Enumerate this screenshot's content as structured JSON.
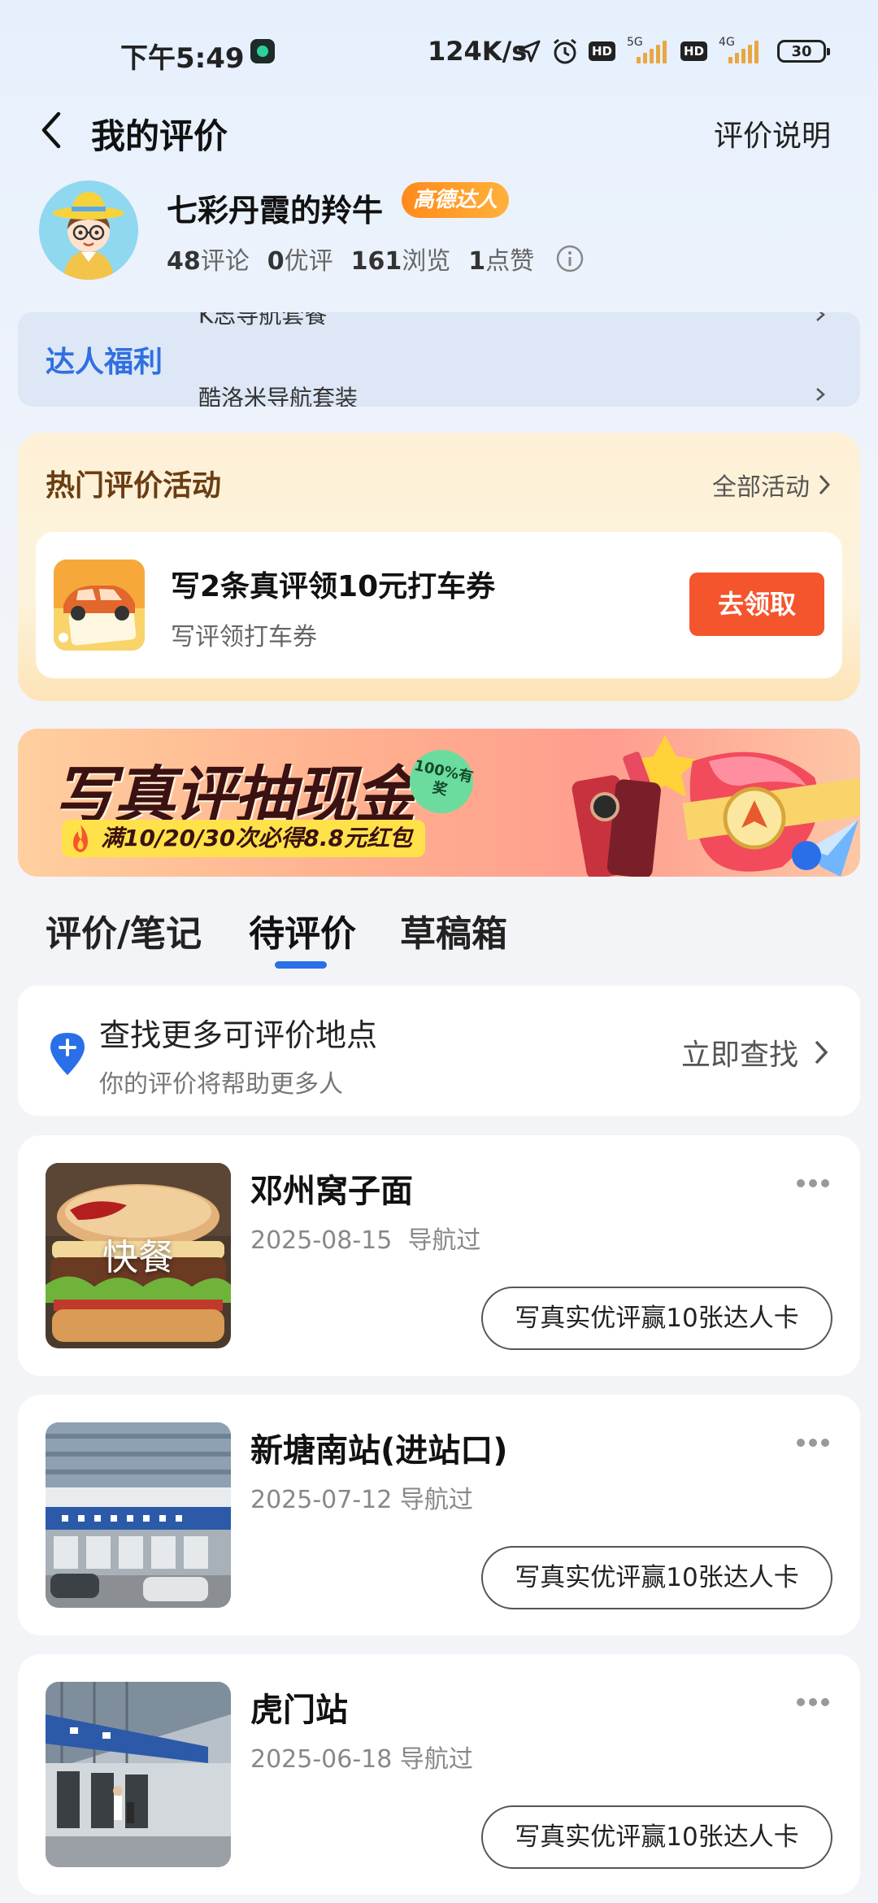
{
  "status_bar": {
    "time": "下午5:49",
    "net_speed": "124K/s",
    "hd1": "HD",
    "hd2": "HD",
    "sim1_type": "5G",
    "sim2_type": "4G",
    "battery": "30"
  },
  "header": {
    "title": "我的评价",
    "rules_link": "评价说明"
  },
  "profile": {
    "username": "七彩丹霞的羚牛",
    "badge": "高德达人",
    "stats": [
      {
        "num": "48",
        "label": "评论"
      },
      {
        "num": "0",
        "label": "优评"
      },
      {
        "num": "161",
        "label": "浏览"
      },
      {
        "num": "1",
        "label": "点赞"
      }
    ]
  },
  "benefits": {
    "title": "达人福利",
    "items": [
      "K志导航套餐",
      "酷洛米导航套装"
    ]
  },
  "activities": {
    "title": "热门评价活动",
    "all_link": "全部活动",
    "card": {
      "title": "写2条真评领10元打车券",
      "subtitle": "写评领打车券",
      "button": "去领取"
    }
  },
  "promo": {
    "title": "写真评抽现金",
    "subtitle": "满10/20/30次必得8.8元红包",
    "seal": "100%有奖"
  },
  "tabs": [
    {
      "label": "评价/笔记"
    },
    {
      "label": "待评价"
    },
    {
      "label": "草稿箱"
    }
  ],
  "find": {
    "title": "查找更多可评价地点",
    "subtitle": "你的评价将帮助更多人",
    "action": "立即查找"
  },
  "places": [
    {
      "name": "邓州窝子面",
      "date": "2025-08-15",
      "status": "导航过",
      "thumb_label": "快餐",
      "button": "写真实优评赢10张达人卡"
    },
    {
      "name": "新塘南站(进站口)",
      "date": "2025-07-12",
      "status": "导航过",
      "thumb_label": "",
      "button": "写真实优评赢10张达人卡"
    },
    {
      "name": "虎门站",
      "date": "2025-06-18",
      "status": "导航过",
      "thumb_label": "",
      "button": "写真实优评赢10张达人卡"
    }
  ],
  "colors": {
    "accent_blue": "#2a6fe8",
    "claim_orange": "#f5552d",
    "badge_orange": "#ff8a1a"
  }
}
